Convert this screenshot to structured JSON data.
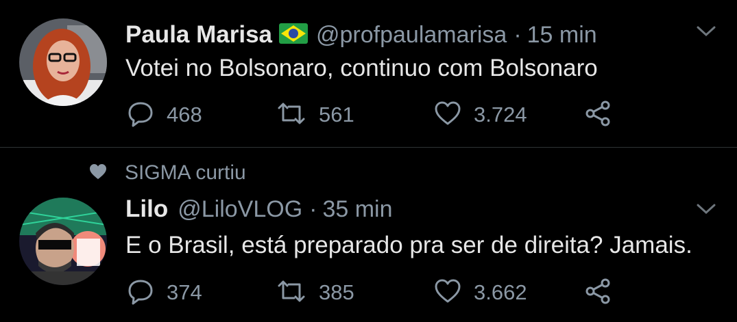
{
  "tweets": [
    {
      "name": "Paula Marisa",
      "handle": "@profpaulamarisa",
      "separator": "·",
      "time": "15 min",
      "text": "Votei no Bolsonaro, continuo com Bolsonaro",
      "replies": "468",
      "retweets": "561",
      "likes": "3.724"
    },
    {
      "context": "SIGMA curtiu",
      "name": "Lilo",
      "handle": "@LiloVLOG",
      "separator": "·",
      "time": "35 min",
      "text": "E o Brasil, está preparado pra ser de direita? Jamais.",
      "replies": "374",
      "retweets": "385",
      "likes": "3.662"
    }
  ],
  "colors": {
    "background": "#000000",
    "text_primary": "#e7e7e7",
    "text_secondary": "#8b98a5",
    "divider": "#2f3336",
    "flag_green": "#229e45",
    "flag_yellow": "#f8e509",
    "flag_blue": "#2b49a3"
  },
  "icons": [
    "reply-icon",
    "retweet-icon",
    "like-icon",
    "share-icon",
    "chevron-down-icon",
    "brazil-flag-icon",
    "heart-context-icon"
  ]
}
